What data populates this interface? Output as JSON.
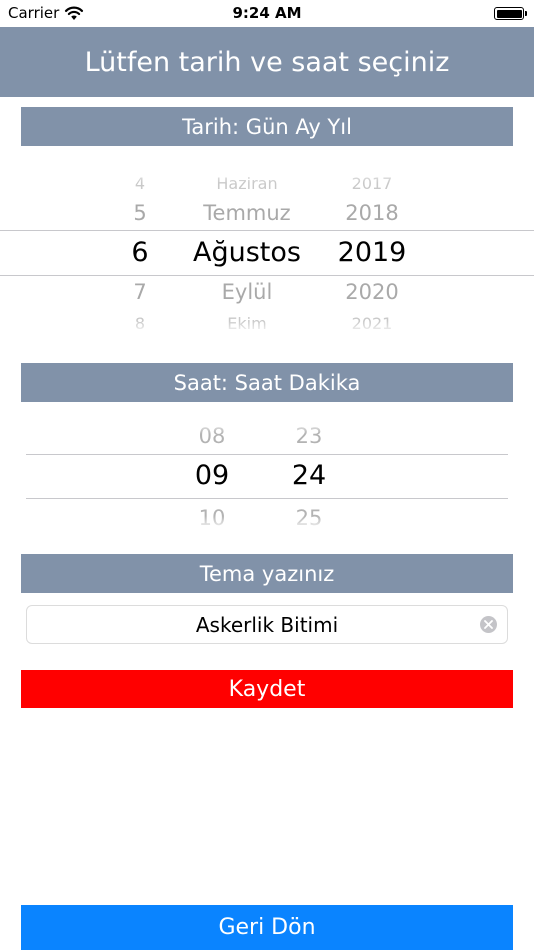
{
  "status_bar": {
    "carrier": "Carrier",
    "time": "9:24 AM"
  },
  "header": {
    "title": "Lütfen tarih ve saat seçiniz"
  },
  "date_section": {
    "label": "Tarih: Gün Ay Yıl"
  },
  "date_picker": {
    "day": [
      "4",
      "5",
      "6",
      "7",
      "8"
    ],
    "month": [
      "Haziran",
      "Temmuz",
      "Ağustos",
      "Eylül",
      "Ekim"
    ],
    "year": [
      "2017",
      "2018",
      "2019",
      "2020",
      "2021"
    ],
    "selected": {
      "day": "6",
      "month": "Ağustos",
      "year": "2019"
    }
  },
  "time_section": {
    "label": "Saat: Saat Dakika"
  },
  "time_picker": {
    "hour": [
      "08",
      "09",
      "10"
    ],
    "minute": [
      "23",
      "24",
      "25"
    ],
    "selected": {
      "hour": "09",
      "minute": "24"
    }
  },
  "theme_section": {
    "label": "Tema yazınız"
  },
  "theme_field": {
    "value": "Askerlik Bitimi"
  },
  "buttons": {
    "save": "Kaydet",
    "back": "Geri Dön"
  },
  "colors": {
    "header": "#8192a9",
    "save": "#ff0000",
    "back": "#0a84ff"
  },
  "icons": {
    "wifi": "wifi-icon",
    "battery": "battery-icon",
    "clear": "clear-icon"
  }
}
